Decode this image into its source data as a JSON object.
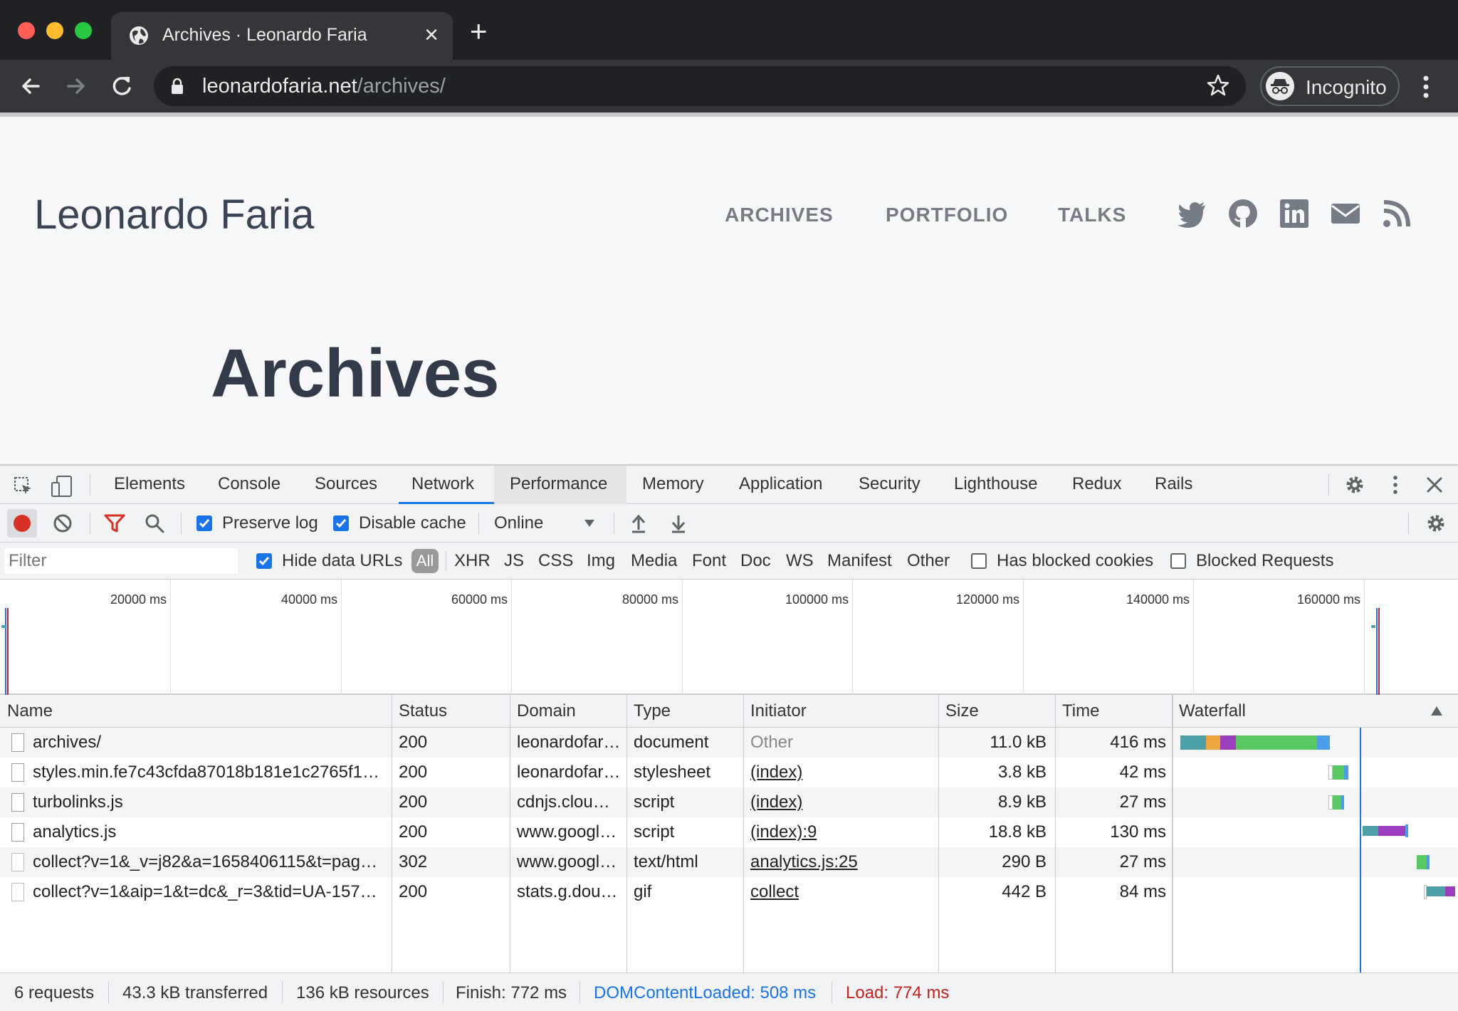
{
  "browser": {
    "tab_title": "Archives · Leonardo Faria",
    "new_tab_symbol": "+",
    "close_symbol": "×",
    "url_host": "leonardofaria.net",
    "url_path": "/archives/",
    "profile_label": "Incognito",
    "icons": [
      "globe-icon",
      "back-icon",
      "forward-icon",
      "reload-icon",
      "lock-icon",
      "star-icon",
      "incognito-icon",
      "kebab-icon"
    ],
    "traffic_colors": [
      "#ff5f57",
      "#febc2e",
      "#28c840"
    ]
  },
  "site": {
    "title": "Leonardo Faria",
    "nav": [
      "ARCHIVES",
      "PORTFOLIO",
      "TALKS"
    ],
    "social_icons": [
      "twitter-icon",
      "github-icon",
      "linkedin-icon",
      "mail-icon",
      "rss-icon"
    ],
    "heading": "Archives"
  },
  "devtools": {
    "tabs": [
      "Elements",
      "Console",
      "Sources",
      "Network",
      "Performance",
      "Memory",
      "Application",
      "Security",
      "Lighthouse",
      "Redux",
      "Rails"
    ],
    "active_tab": "Network",
    "toolbar": {
      "preserve_log": "Preserve log",
      "preserve_log_checked": true,
      "disable_cache": "Disable cache",
      "disable_cache_checked": true,
      "throttling": "Online"
    },
    "filter": {
      "placeholder": "Filter",
      "hide_data_urls": "Hide data URLs",
      "types": [
        "All",
        "XHR",
        "JS",
        "CSS",
        "Img",
        "Media",
        "Font",
        "Doc",
        "WS",
        "Manifest",
        "Other"
      ],
      "has_blocked_cookies": "Has blocked cookies",
      "blocked_requests": "Blocked Requests"
    },
    "overview_ticks": [
      "20000 ms",
      "40000 ms",
      "60000 ms",
      "80000 ms",
      "100000 ms",
      "120000 ms",
      "140000 ms",
      "160000 ms"
    ],
    "columns": [
      "Name",
      "Status",
      "Domain",
      "Type",
      "Initiator",
      "Size",
      "Time",
      "Waterfall"
    ],
    "rows": [
      {
        "name": "archives/",
        "status": "200",
        "domain": "leonardofar…",
        "type": "document",
        "initiator": "Other",
        "size": "11.0 kB",
        "time": "416 ms"
      },
      {
        "name": "styles.min.fe7c43cfda87018b181e1c2765f1…",
        "status": "200",
        "domain": "leonardofar…",
        "type": "stylesheet",
        "initiator": "(index)",
        "size": "3.8 kB",
        "time": "42 ms"
      },
      {
        "name": "turbolinks.js",
        "status": "200",
        "domain": "cdnjs.clou…",
        "type": "script",
        "initiator": "(index)",
        "size": "8.9 kB",
        "time": "27 ms"
      },
      {
        "name": "analytics.js",
        "status": "200",
        "domain": "www.googl…",
        "type": "script",
        "initiator": "(index):9",
        "size": "18.8 kB",
        "time": "130 ms"
      },
      {
        "name": "collect?v=1&_v=j82&a=1658406115&t=pag…",
        "status": "302",
        "domain": "www.googl…",
        "type": "text/html",
        "initiator": "analytics.js:25",
        "size": "290 B",
        "time": "27 ms"
      },
      {
        "name": "collect?v=1&aip=1&t=dc&_r=3&tid=UA-157…",
        "status": "200",
        "domain": "stats.g.dou…",
        "type": "gif",
        "initiator": "collect",
        "size": "442 B",
        "time": "84 ms"
      }
    ],
    "status_bar": {
      "requests": "6 requests",
      "transferred": "43.3 kB transferred",
      "resources": "136 kB resources",
      "finish": "Finish: 772 ms",
      "dom_content_loaded": "DOMContentLoaded: 508 ms",
      "load": "Load: 774 ms",
      "dcl_color": "#1a73e8",
      "load_color": "#c5221f"
    }
  }
}
